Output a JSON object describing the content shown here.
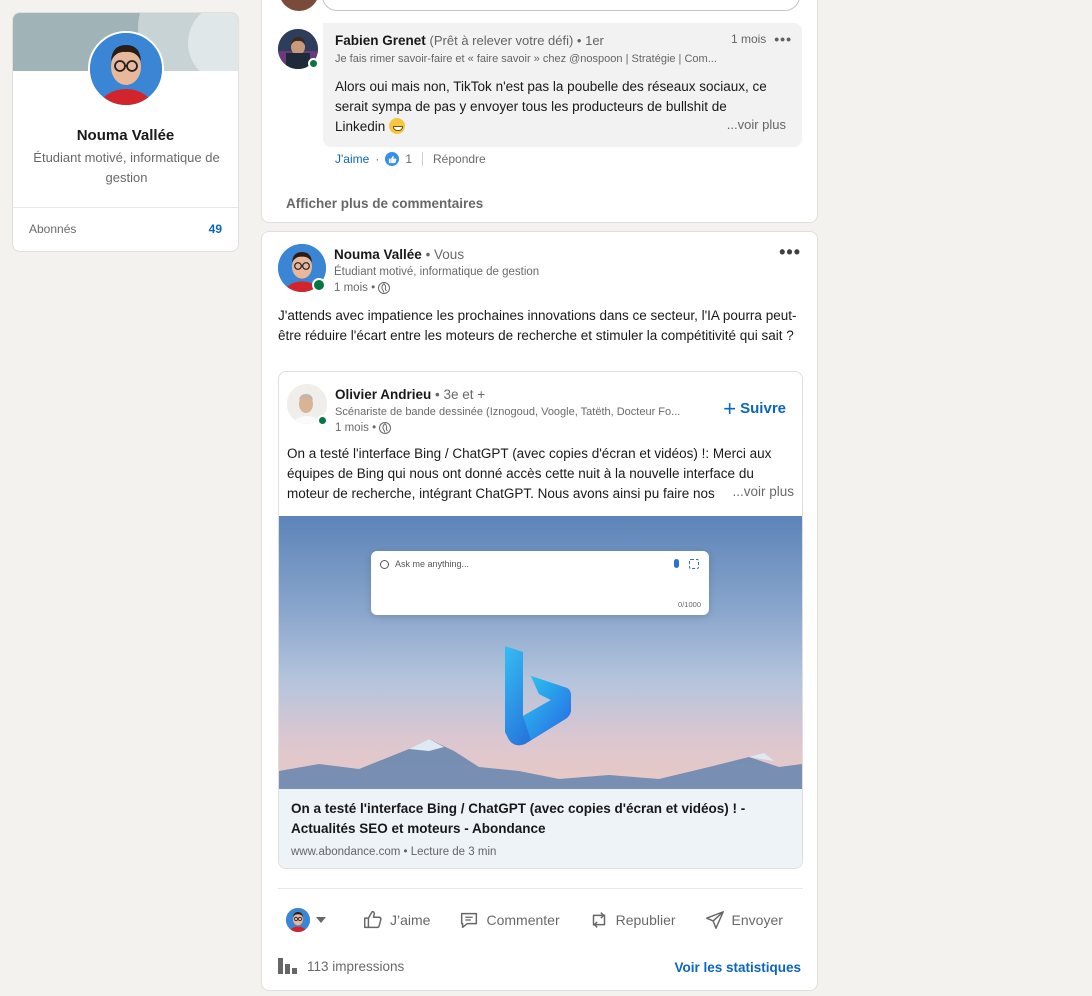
{
  "profile": {
    "name": "Nouma Vallée",
    "headline": "Étudiant motivé, informatique de gestion",
    "stat_label": "Abonnés",
    "stat_value": "49"
  },
  "comment": {
    "author": "Fabien Grenet",
    "author_extra": "(Prêt à relever votre défi) • 1er",
    "time": "1 mois",
    "headline": "Je fais rimer savoir-faire et « faire savoir » chez @nospoon | Stratégie | Com...",
    "text": "Alors oui mais non, TikTok n'est pas la poubelle des réseaux sociaux, ce serait sympa de pas y envoyer tous les producteurs de bullshit de Linkedin",
    "see_more": "...voir plus",
    "like_label": "J'aime",
    "like_count": "1",
    "reply_label": "Répondre",
    "more_comments": "Afficher plus de commentaires"
  },
  "post": {
    "author": "Nouma Vallée",
    "author_extra": "• Vous",
    "headline": "Étudiant motivé, informatique de gestion",
    "time": "1 mois •",
    "text": "J'attends avec impatience les prochaines innovations dans ce secteur, l'IA pourra peut-être réduire l'écart entre les moteurs de recherche et stimuler la compétitivité qui sait ?",
    "shared": {
      "author": "Olivier Andrieu",
      "author_extra": "• 3e et +",
      "headline": "Scénariste de bande dessinée (Iznogoud, Voogle, Tatëth, Docteur Fo...",
      "time": "1 mois •",
      "follow_label": "Suivre",
      "text": "On a testé l'interface Bing / ChatGPT (avec copies d'écran et vidéos) !: Merci aux équipes de Bing qui nous ont donné accès cette nuit à la nouvelle interface du moteur de recherche, intégrant ChatGPT. Nous avons ainsi pu faire nos",
      "see_more": "...voir plus",
      "image": {
        "search_placeholder": "Ask me anything...",
        "char_count": "0/1000"
      },
      "link_title": "On a testé l'interface Bing / ChatGPT (avec copies d'écran et vidéos) ! - Actualités SEO et moteurs - Abondance",
      "link_sub": "www.abondance.com • Lecture de 3 min"
    },
    "actions": {
      "like": "J’aime",
      "comment": "Commenter",
      "repost": "Republier",
      "send": "Envoyer"
    },
    "impressions": "113 impressions",
    "stats_link": "Voir les statistiques"
  },
  "colors": {
    "accent": "#0a66c2",
    "online": "#057642",
    "background": "#f4f2ee"
  }
}
